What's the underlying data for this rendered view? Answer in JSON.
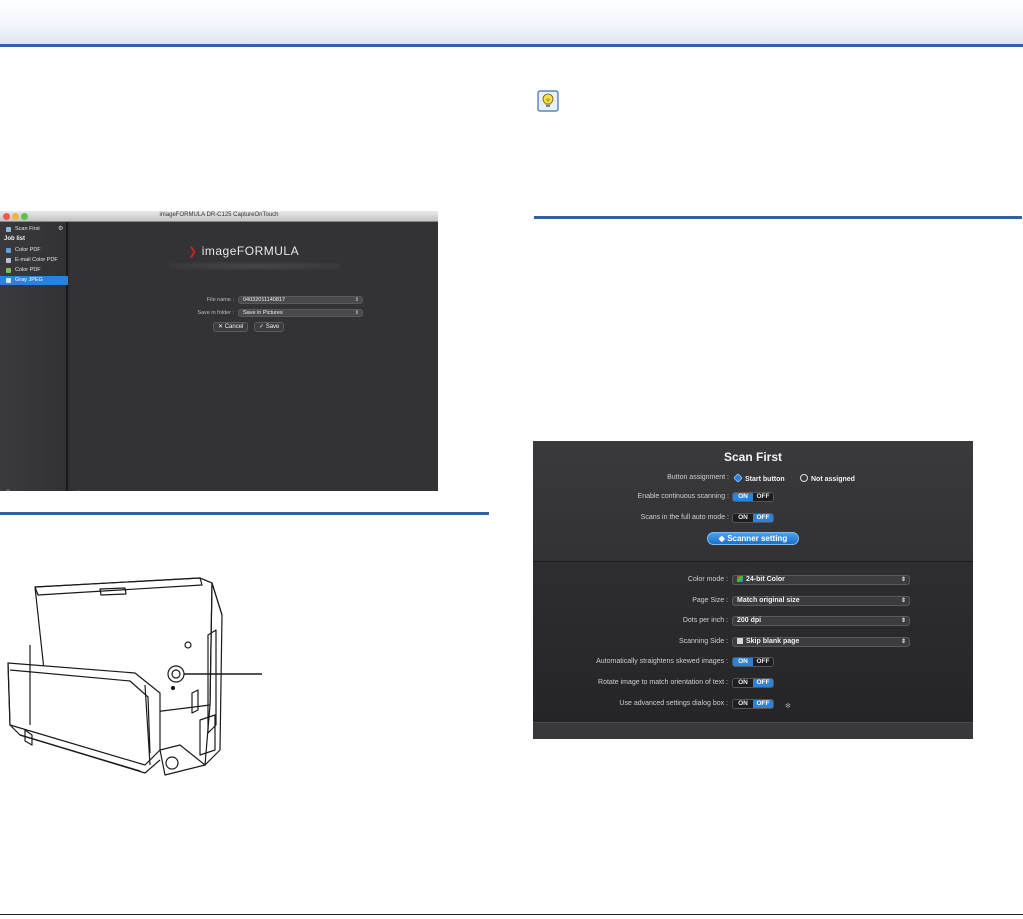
{
  "colors": {
    "rule_blue": "#2f63a8",
    "highlight_blue": "#2a82da",
    "panel_dark": "#2b2b2d"
  },
  "capture_on_touch": {
    "window_title": "imageFORMULA DR-C125 CaptureOnTouch",
    "sidebar": {
      "scan_first": "Scan First",
      "job_list_header": "Job list",
      "jobs": [
        "Color PDF",
        "E-mail Color PDF",
        "Color PDF",
        "Gray JPEG"
      ]
    },
    "logo_text": "imageFORMULA",
    "file_name_label": "File name :",
    "file_name_value": "04032011140817",
    "save_folder_label": "Save in folder :",
    "save_folder_value": "Save in Pictures",
    "cancel_label": "Cancel",
    "save_label": "Save"
  },
  "scan_first_panel": {
    "title": "Scan First",
    "button_assignment_label": "Button assignment :",
    "start_button_label": "Start button",
    "not_assigned_label": "Not assigned",
    "continuous_label": "Enable continuous scanning :",
    "full_auto_label": "Scans in the full auto mode :",
    "scanner_setting_label": "Scanner setting",
    "color_mode_label": "Color mode :",
    "color_mode_value": "24-bit Color",
    "page_size_label": "Page Size :",
    "page_size_value": "Match original size",
    "dpi_label": "Dots per inch :",
    "dpi_value": "200 dpi",
    "scanning_side_label": "Scanning Side :",
    "scanning_side_value": "Skip blank page",
    "deskew_label": "Automatically straightens skewed images :",
    "rotate_label": "Rotate image to match orientation of text :",
    "advanced_label": "Use advanced settings dialog box :",
    "on": "ON",
    "off": "OFF"
  }
}
